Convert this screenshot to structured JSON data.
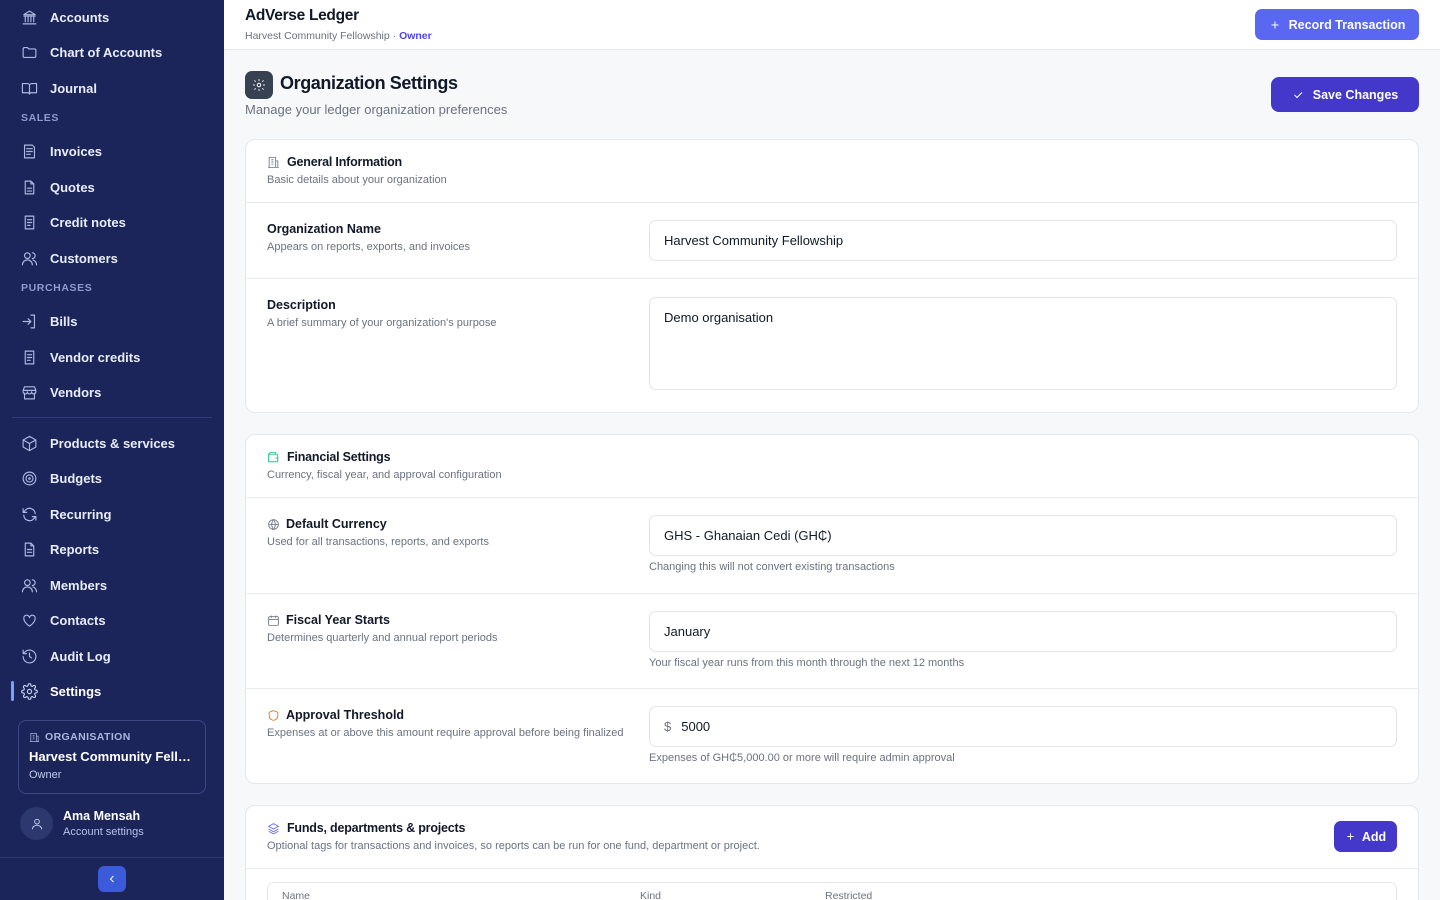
{
  "sidebar": {
    "nav_top": [
      {
        "label": "Accounts",
        "icon": "bank-icon"
      },
      {
        "label": "Chart of Accounts",
        "icon": "folder-icon"
      },
      {
        "label": "Journal",
        "icon": "book-icon"
      }
    ],
    "section_sales": "SALES",
    "nav_sales": [
      {
        "label": "Invoices",
        "icon": "invoice-icon"
      },
      {
        "label": "Quotes",
        "icon": "document-icon"
      },
      {
        "label": "Credit notes",
        "icon": "credit-note-icon"
      },
      {
        "label": "Customers",
        "icon": "users-icon"
      }
    ],
    "section_purchases": "PURCHASES",
    "nav_purchases": [
      {
        "label": "Bills",
        "icon": "bill-icon"
      },
      {
        "label": "Vendor credits",
        "icon": "document-icon"
      },
      {
        "label": "Vendors",
        "icon": "store-icon"
      }
    ],
    "nav_other": [
      {
        "label": "Products & services",
        "icon": "box-icon"
      },
      {
        "label": "Budgets",
        "icon": "target-icon"
      },
      {
        "label": "Recurring",
        "icon": "refresh-icon"
      },
      {
        "label": "Reports",
        "icon": "report-icon"
      },
      {
        "label": "Members",
        "icon": "users-icon"
      },
      {
        "label": "Contacts",
        "icon": "heart-icon"
      },
      {
        "label": "Audit Log",
        "icon": "history-icon"
      },
      {
        "label": "Settings",
        "icon": "gear-icon"
      }
    ],
    "active_item": "Settings",
    "org_card": {
      "label": "ORGANISATION",
      "name": "Harvest Community Fello...",
      "role": "Owner"
    },
    "user": {
      "name": "Ama Mensah",
      "sub": "Account settings"
    }
  },
  "header": {
    "app_title": "AdVerse Ledger",
    "org_name": "Harvest Community Fellowship",
    "separator": " · ",
    "role": "Owner",
    "record_button": "Record Transaction"
  },
  "page": {
    "title": "Organization Settings",
    "subtitle": "Manage your ledger organization preferences",
    "save_button": "Save Changes"
  },
  "general": {
    "title": "General Information",
    "subtitle": "Basic details about your organization",
    "org_name_label": "Organization Name",
    "org_name_help": "Appears on reports, exports, and invoices",
    "org_name_value": "Harvest Community Fellowship",
    "description_label": "Description",
    "description_help": "A brief summary of your organization's purpose",
    "description_value": "Demo organisation"
  },
  "financial": {
    "title": "Financial Settings",
    "subtitle": "Currency, fiscal year, and approval configuration",
    "currency_label": "Default Currency",
    "currency_help": "Used for all transactions, reports, and exports",
    "currency_value": "GHS - Ghanaian Cedi (GH₵)",
    "currency_note": "Changing this will not convert existing transactions",
    "fiscal_label": "Fiscal Year Starts",
    "fiscal_help": "Determines quarterly and annual report periods",
    "fiscal_value": "January",
    "fiscal_note": "Your fiscal year runs from this month through the next 12 months",
    "approval_label": "Approval Threshold",
    "approval_help": "Expenses at or above this amount require approval before being finalized",
    "approval_prefix": "$",
    "approval_value": "5000",
    "approval_note": "Expenses of GH₵5,000.00 or more will require admin approval"
  },
  "funds": {
    "title": "Funds, departments & projects",
    "subtitle": "Optional tags for transactions and invoices, so reports can be run for one fund, department or project.",
    "add_button": "Add",
    "columns": [
      "Name",
      "Kind",
      "Restricted"
    ]
  },
  "colors": {
    "sidebar_bg": "#1b2559",
    "accent": "#4338ca",
    "accent_light": "#5a67f0",
    "financial_icon": "#10b981",
    "approval_icon": "#d97706"
  }
}
